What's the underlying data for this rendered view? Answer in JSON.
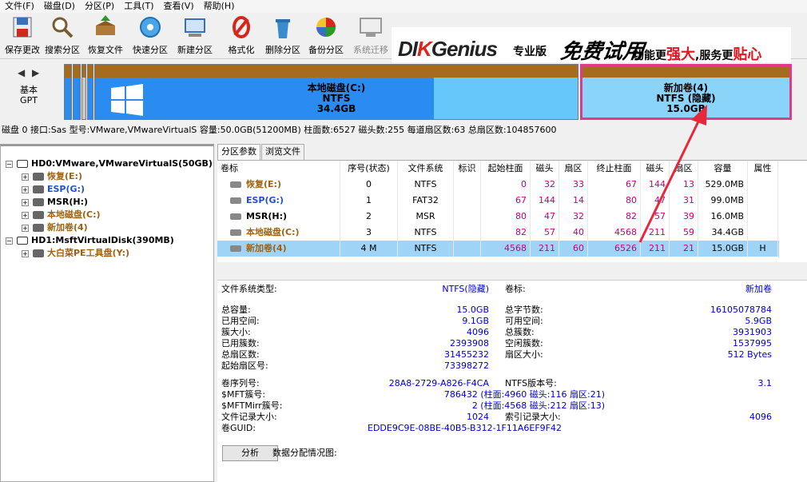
{
  "menu": [
    "文件(F)",
    "磁盘(D)",
    "分区(P)",
    "工具(T)",
    "查看(V)",
    "帮助(H)"
  ],
  "toolbar": [
    {
      "label": "保存更改",
      "icon": "save-icon",
      "enabled": true
    },
    {
      "label": "搜索分区",
      "icon": "search-icon",
      "enabled": true
    },
    {
      "label": "恢复文件",
      "icon": "recover-icon",
      "enabled": true
    },
    {
      "label": "快速分区",
      "icon": "quick-partition-icon",
      "enabled": true
    },
    {
      "label": "新建分区",
      "icon": "new-partition-icon",
      "enabled": true
    },
    {
      "label": "格式化",
      "icon": "format-icon",
      "enabled": true
    },
    {
      "label": "删除分区",
      "icon": "delete-icon",
      "enabled": true
    },
    {
      "label": "备份分区",
      "icon": "backup-icon",
      "enabled": true
    },
    {
      "label": "系统迁移",
      "icon": "migrate-icon",
      "enabled": false
    }
  ],
  "banner": {
    "brand_a": "DI",
    "brand_k": "K",
    "brand_b": "Genius",
    "edition": "专业版",
    "promo": "免费试用",
    "slogan_a": "功能更",
    "slogan_b": "强大",
    "slogan_c": ",服务更",
    "slogan_d": "贴心"
  },
  "disk_map": {
    "label1": "基本",
    "label2": "GPT",
    "partitions": [
      {
        "name": "本地磁盘(C:)",
        "fs": "NTFS",
        "size": "34.4GB"
      },
      {
        "name": "新加卷(4)",
        "fs": "NTFS (隐藏)",
        "size": "15.0GB"
      }
    ]
  },
  "disk_info": "磁盘 0 接口:Sas  型号:VMware,VMwareVirtualS  容量:50.0GB(51200MB)  柱面数:6527  磁头数:255  每道扇区数:63  总扇区数:104857600",
  "tree": [
    {
      "label": "HD0:VMware,VMwareVirtualS(50GB)",
      "level": 0,
      "color": "#000"
    },
    {
      "label": "恢复(E:)",
      "level": 1,
      "color": "#a0620e"
    },
    {
      "label": "ESP(G:)",
      "level": 1,
      "color": "#2050d0"
    },
    {
      "label": "MSR(H:)",
      "level": 1,
      "color": "#000"
    },
    {
      "label": "本地磁盘(C:)",
      "level": 1,
      "color": "#a0620e"
    },
    {
      "label": "新加卷(4)",
      "level": 1,
      "color": "#a0620e"
    },
    {
      "label": "HD1:MsftVirtualDisk(390MB)",
      "level": 0,
      "color": "#000"
    },
    {
      "label": "大白菜PE工具盘(Y:)",
      "level": 1,
      "color": "#a0620e"
    }
  ],
  "tabs": [
    "分区参数",
    "浏览文件"
  ],
  "table": {
    "headers": [
      "卷标",
      "序号(状态)",
      "文件系统",
      "标识",
      "起始柱面",
      "磁头",
      "扇区",
      "终止柱面",
      "磁头",
      "扇区",
      "容量",
      "属性"
    ],
    "rows": [
      [
        "恢复(E:)",
        "0",
        "NTFS",
        "",
        "0",
        "32",
        "33",
        "67",
        "144",
        "13",
        "529.0MB",
        ""
      ],
      [
        "ESP(G:)",
        "1",
        "FAT32",
        "",
        "67",
        "144",
        "14",
        "80",
        "47",
        "31",
        "99.0MB",
        ""
      ],
      [
        "MSR(H:)",
        "2",
        "MSR",
        "",
        "80",
        "47",
        "32",
        "82",
        "57",
        "39",
        "16.0MB",
        ""
      ],
      [
        "本地磁盘(C:)",
        "3",
        "NTFS",
        "",
        "82",
        "57",
        "40",
        "4568",
        "211",
        "59",
        "34.4GB",
        ""
      ],
      [
        "新加卷(4)",
        "4 M",
        "NTFS",
        "",
        "4568",
        "211",
        "60",
        "6526",
        "211",
        "21",
        "15.0GB",
        "H"
      ]
    ]
  },
  "details": {
    "fs_type_label": "文件系统类型:",
    "fs_type": "NTFS(隐藏)",
    "vol_label_label": "卷标:",
    "vol_label": "新加卷",
    "left": [
      [
        "总容量:",
        "15.0GB"
      ],
      [
        "已用空间:",
        "9.1GB"
      ],
      [
        "簇大小:",
        "4096"
      ],
      [
        "已用簇数:",
        "2393908"
      ],
      [
        "总扇区数:",
        "31455232"
      ],
      [
        "起始扇区号:",
        "73398272"
      ]
    ],
    "right": [
      [
        "总字节数:",
        "16105078784"
      ],
      [
        "可用空间:",
        "5.9GB"
      ],
      [
        "总簇数:",
        "3931903"
      ],
      [
        "空闲簇数:",
        "1537995"
      ],
      [
        "扇区大小:",
        "512 Bytes"
      ]
    ],
    "serial_label": "卷序列号:",
    "serial": "28A8-2729-A826-F4CA",
    "ntfsver_label": "NTFS版本号:",
    "ntfsver": "3.1",
    "mft_label": "$MFT簇号:",
    "mft": "786432 (柱面:4960 磁头:116 扇区:21)",
    "mftmirr_label": "$MFTMirr簇号:",
    "mftmirr": "2 (柱面:4568 磁头:212 扇区:13)",
    "rec_label": "文件记录大小:",
    "rec": "1024",
    "idx_label": "索引记录大小:",
    "idx": "4096",
    "guid_label": "卷GUID:",
    "guid": "EDDE9C9E-08BE-40B5-B312-1F11A6EF9F42",
    "analyze_button": "分析",
    "dist_label": "数据分配情况图:"
  },
  "colors": {
    "accent_pink": "#e03a8a",
    "selection": "#9fd4f7",
    "value_blue": "#0000c8",
    "arrow_red": "#e8283a"
  }
}
